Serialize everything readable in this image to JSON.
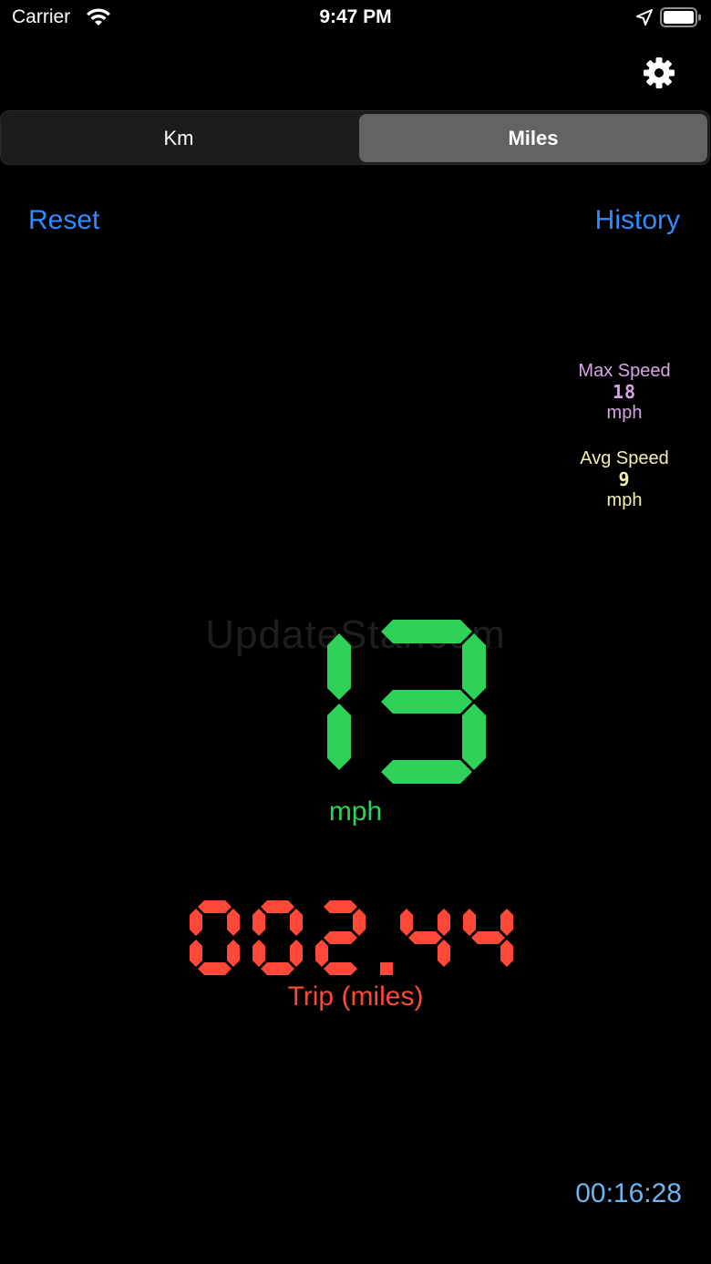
{
  "status_bar": {
    "carrier": "Carrier",
    "time": "9:47 PM"
  },
  "units": {
    "options": [
      "Km",
      "Miles"
    ],
    "selected": "Miles"
  },
  "actions": {
    "reset_label": "Reset",
    "history_label": "History"
  },
  "max_speed": {
    "label": "Max Speed",
    "value": "18",
    "unit": "mph"
  },
  "avg_speed": {
    "label": "Avg Speed",
    "value": "9",
    "unit": "mph"
  },
  "speed": {
    "value": "13",
    "unit": "mph"
  },
  "trip": {
    "value": "002.44",
    "label": "Trip (miles)"
  },
  "timer": "00:16:28",
  "watermark": "UpdateStar.com",
  "colors": {
    "speed": "#2fd158",
    "trip": "#ff4838",
    "link": "#2e8cff",
    "max": "#d8a4e8",
    "avg": "#f3efad",
    "timer": "#6fb4ee"
  },
  "icons": [
    "wifi-icon",
    "location-arrow-icon",
    "battery-icon",
    "gear-icon"
  ]
}
